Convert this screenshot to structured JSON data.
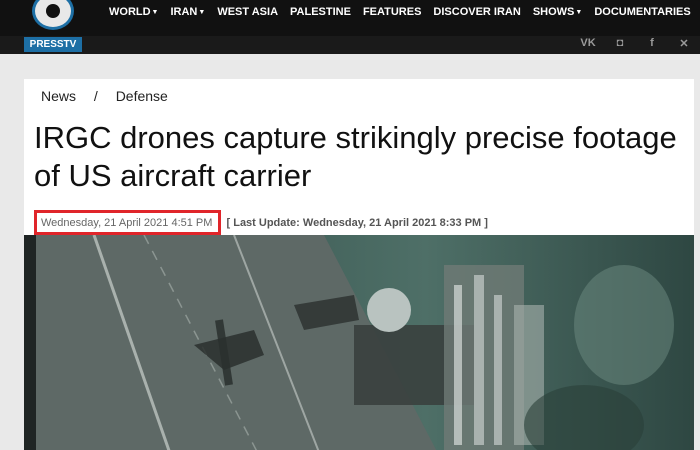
{
  "header": {
    "logo_text": "PRESSTV",
    "nav": [
      {
        "label": "WORLD",
        "dropdown": true
      },
      {
        "label": "IRAN",
        "dropdown": true
      },
      {
        "label": "WEST ASIA",
        "dropdown": false
      },
      {
        "label": "PALESTINE",
        "dropdown": false
      },
      {
        "label": "FEATURES",
        "dropdown": false
      },
      {
        "label": "DISCOVER IRAN",
        "dropdown": false
      },
      {
        "label": "SHOWS",
        "dropdown": true
      },
      {
        "label": "DOCUMENTARIES",
        "dropdown": false
      }
    ],
    "socials": [
      {
        "icon": "vk-icon",
        "glyph": "VK"
      },
      {
        "icon": "shield-icon",
        "glyph": "◘"
      },
      {
        "icon": "facebook-icon",
        "glyph": "f"
      },
      {
        "icon": "x-icon",
        "glyph": "✕"
      }
    ]
  },
  "article": {
    "breadcrumb": [
      "News",
      "/",
      "Defense"
    ],
    "headline": "IRGC drones capture strikingly precise footage of US aircraft carrier",
    "published": "Wednesday, 21 April 2021 4:51 PM",
    "last_update": "[ Last Update: Wednesday, 21 April 2021 8:33 PM ]"
  },
  "colors": {
    "header_bg": "#111111",
    "brand_blue": "#1d6fa5",
    "highlight_red": "#e0252a"
  }
}
